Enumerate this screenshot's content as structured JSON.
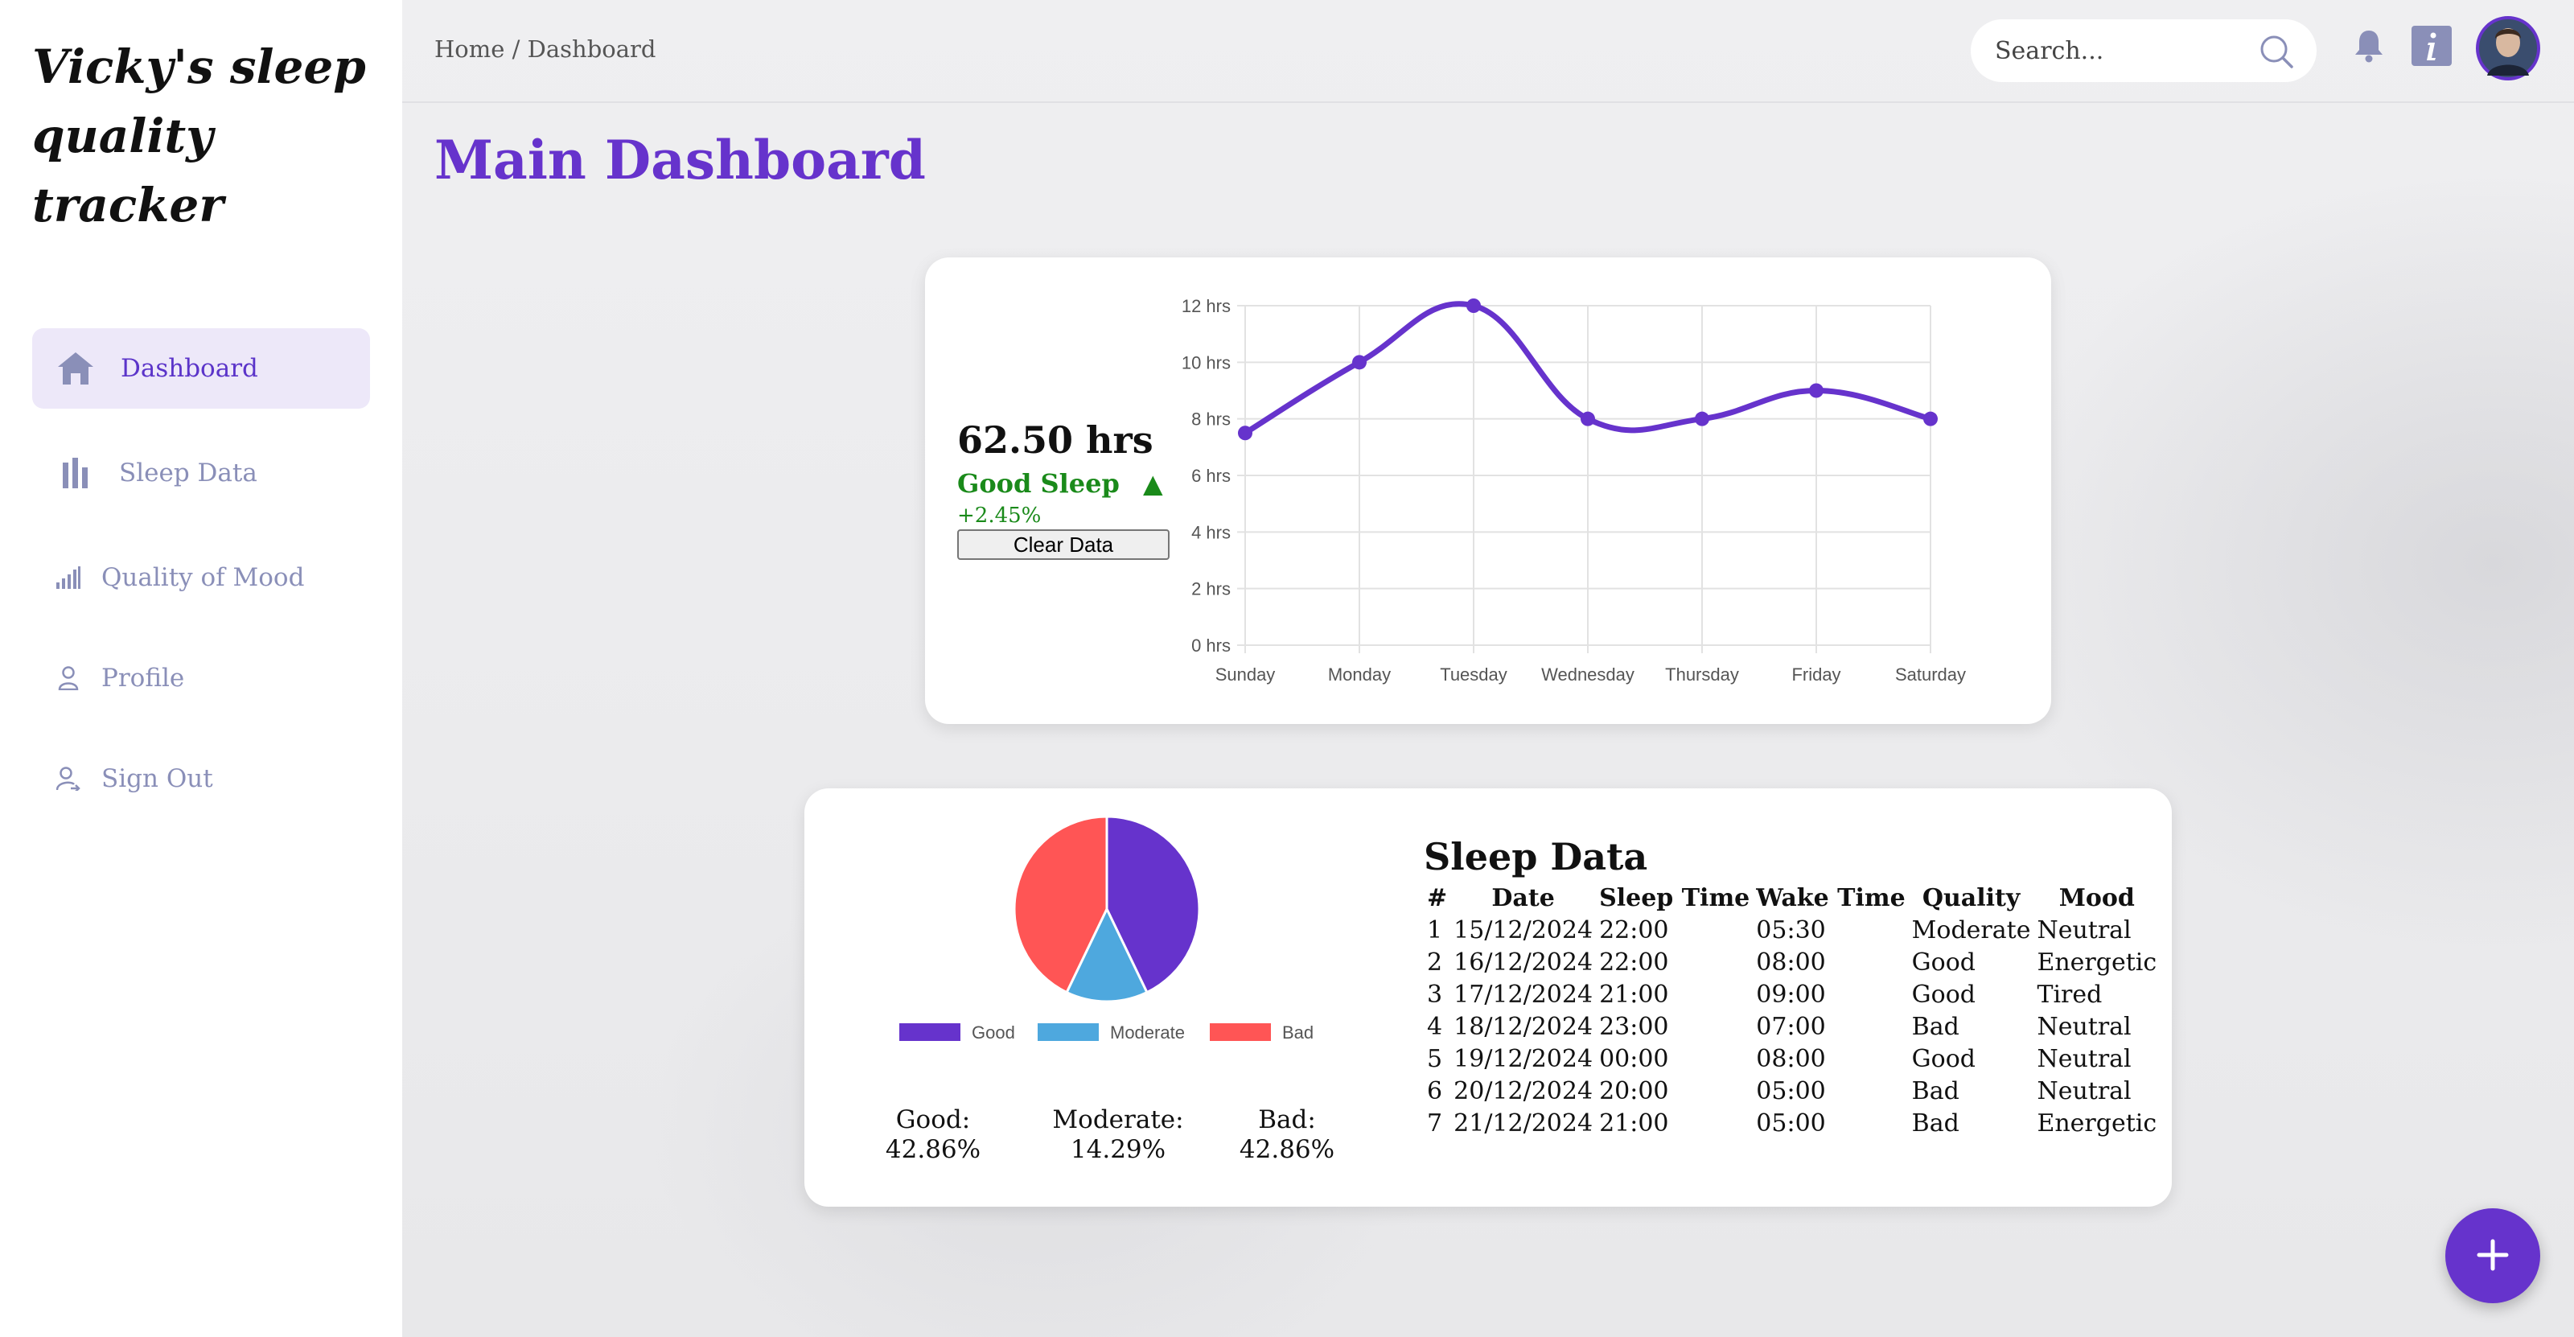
{
  "app": {
    "brand": "Vicky's sleep quality tracker"
  },
  "sidebar": {
    "items": [
      {
        "label": "Dashboard",
        "icon": "home-icon",
        "active": true
      },
      {
        "label": "Sleep Data",
        "icon": "bar-chart-icon",
        "active": false
      },
      {
        "label": "Quality of Mood",
        "icon": "signal-chart-icon",
        "active": false
      },
      {
        "label": "Profile",
        "icon": "user-icon",
        "active": false
      },
      {
        "label": "Sign Out",
        "icon": "sign-out-user-icon",
        "active": false
      }
    ]
  },
  "header": {
    "breadcrumb": "Home / Dashboard",
    "search_placeholder": "Search...",
    "icons": [
      "search-icon",
      "bell-icon",
      "info-icon",
      "avatar"
    ]
  },
  "main": {
    "title": "Main Dashboard",
    "summary": {
      "total": "62.50 hrs",
      "status": "Good Sleep",
      "status_icon": "triangle-up-icon",
      "change": "+2.45%",
      "clear_button": "Clear Data"
    },
    "percentages": [
      {
        "label": "Good:",
        "value": "42.86%"
      },
      {
        "label": "Moderate:",
        "value": "14.29%"
      },
      {
        "label": "Bad:",
        "value": "42.86%"
      }
    ],
    "table": {
      "title": "Sleep Data",
      "headers": [
        "#",
        "Date",
        "Sleep Time",
        "Wake Time",
        "Quality",
        "Mood"
      ],
      "rows": [
        [
          "1",
          "15/12/2024",
          "22:00",
          "05:30",
          "Moderate",
          "Neutral"
        ],
        [
          "2",
          "16/12/2024",
          "22:00",
          "08:00",
          "Good",
          "Energetic"
        ],
        [
          "3",
          "17/12/2024",
          "21:00",
          "09:00",
          "Good",
          "Tired"
        ],
        [
          "4",
          "18/12/2024",
          "23:00",
          "07:00",
          "Bad",
          "Neutral"
        ],
        [
          "5",
          "19/12/2024",
          "00:00",
          "08:00",
          "Good",
          "Neutral"
        ],
        [
          "6",
          "20/12/2024",
          "20:00",
          "05:00",
          "Bad",
          "Neutral"
        ],
        [
          "7",
          "21/12/2024",
          "21:00",
          "05:00",
          "Bad",
          "Energetic"
        ]
      ]
    }
  },
  "colors": {
    "accent": "#6633cc",
    "good": "#6633cc",
    "moderate": "#4ea8de",
    "bad": "#ff5555",
    "positive": "#1a8a1a"
  },
  "chart_data": [
    {
      "type": "line",
      "categories": [
        "Sunday",
        "Monday",
        "Tuesday",
        "Wednesday",
        "Thursday",
        "Friday",
        "Saturday"
      ],
      "values": [
        7.5,
        10,
        12,
        8,
        8,
        9,
        8
      ],
      "y_ticks": [
        "0 hrs",
        "2 hrs",
        "4 hrs",
        "6 hrs",
        "8 hrs",
        "10 hrs",
        "12 hrs"
      ],
      "ylim": [
        0,
        12
      ],
      "grid": true,
      "color": "#6633cc"
    },
    {
      "type": "pie",
      "categories": [
        "Good",
        "Moderate",
        "Bad"
      ],
      "values": [
        3,
        1,
        3
      ],
      "colors": [
        "#6633cc",
        "#4ea8de",
        "#ff5555"
      ],
      "legend": "bottom"
    }
  ]
}
